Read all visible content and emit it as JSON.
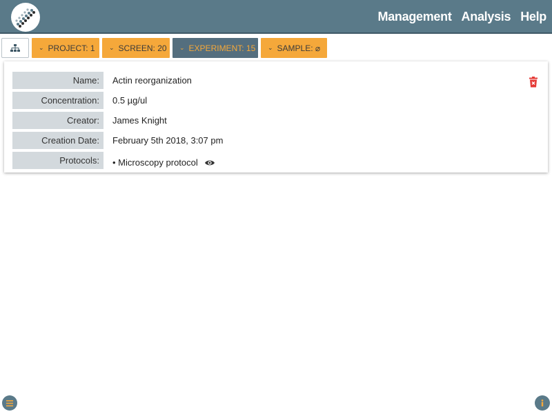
{
  "header": {
    "nav": [
      "Management",
      "Analysis",
      "Help"
    ]
  },
  "breadcrumbs": [
    {
      "label": "PROJECT: 1",
      "active": false
    },
    {
      "label": "SCREEN: 20",
      "active": false
    },
    {
      "label": "EXPERIMENT: 15",
      "active": true
    },
    {
      "label": "SAMPLE: ⌀",
      "active": false
    }
  ],
  "details": {
    "fields": [
      {
        "label": "Name:",
        "value": "Actin reorganization"
      },
      {
        "label": "Concentration:",
        "value": "0.5 µg/ul"
      },
      {
        "label": "Creator:",
        "value": "James Knight"
      },
      {
        "label": "Creation Date:",
        "value": "February 5th 2018, 3:07 pm"
      },
      {
        "label": "Protocols:",
        "value": "• Microscopy protocol"
      }
    ]
  },
  "colors": {
    "topbar": "#5a7a89",
    "crumb": "#f5a83a",
    "crumb_active": "#546e7e",
    "label_bg": "#d3d9dd",
    "delete": "#e53935"
  },
  "icons": {
    "logo": "dna-logo-icon",
    "tree": "hierarchy-icon",
    "chevron": "chevron-down-icon",
    "delete": "trash-icon",
    "view": "eye-icon",
    "menu": "menu-icon",
    "info": "info-icon"
  }
}
